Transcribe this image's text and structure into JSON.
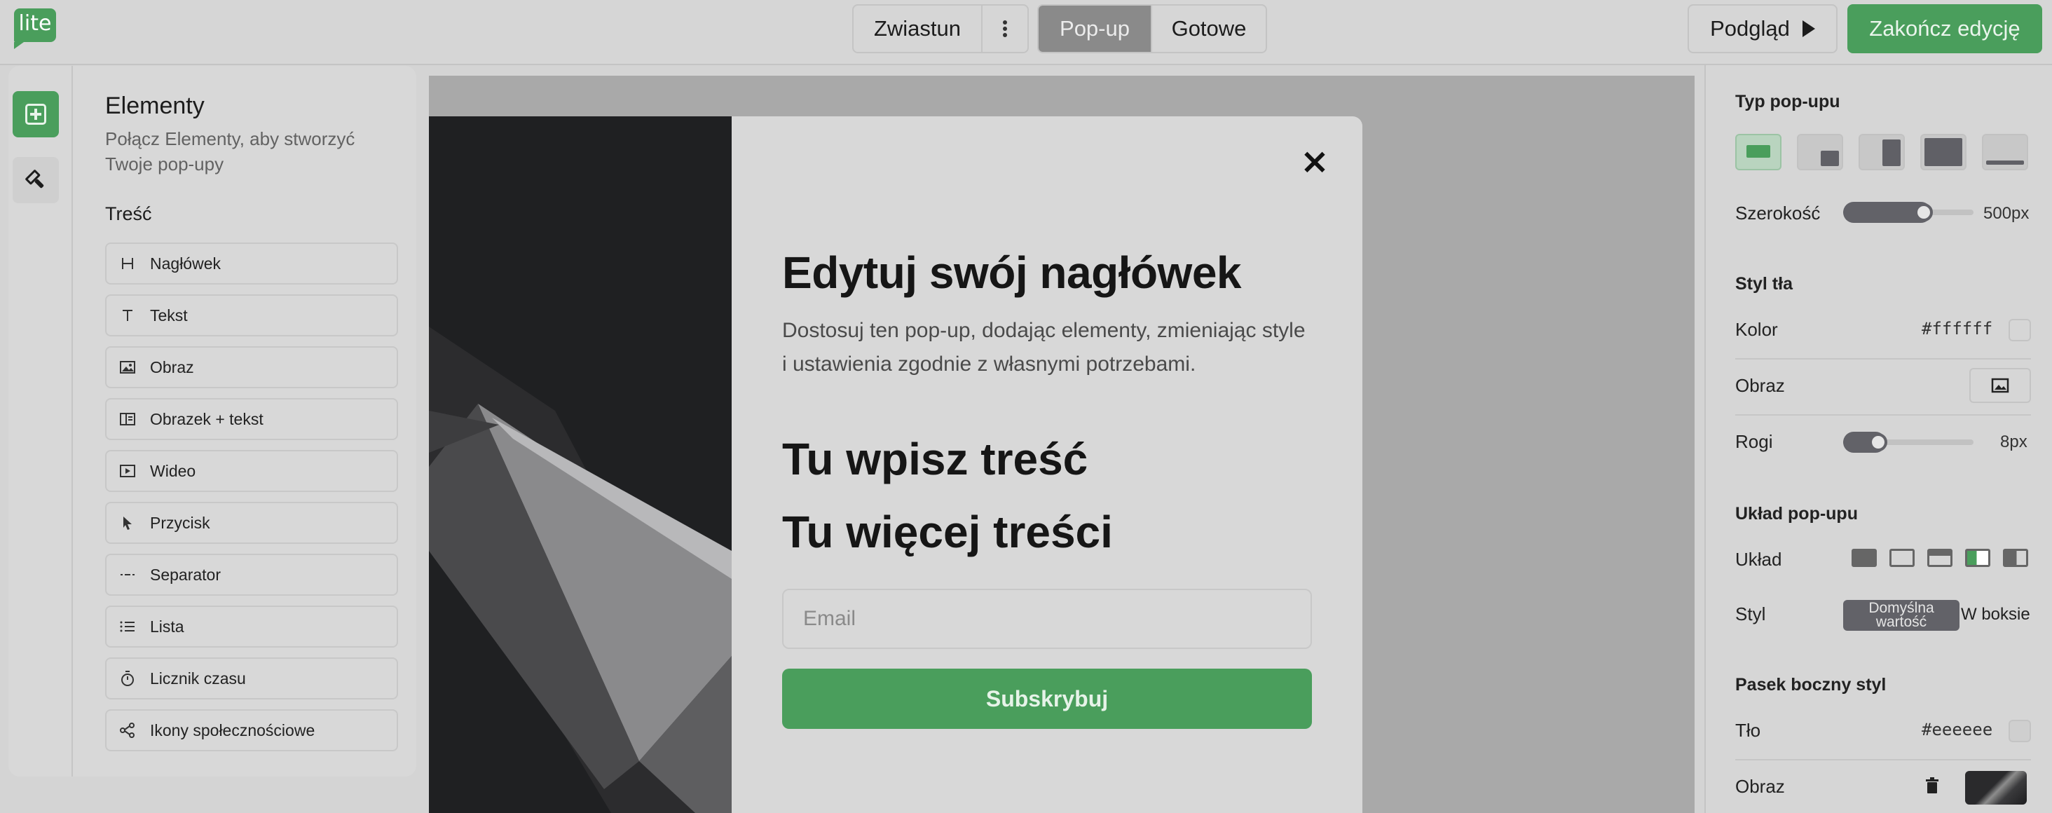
{
  "app": {
    "logo_text": "lite"
  },
  "header": {
    "tabs_left": [
      "Zwiastun"
    ],
    "tabs_right": [
      "Pop-up",
      "Gotowe"
    ],
    "active_tab": "Pop-up",
    "preview_label": "Podgląd",
    "finish_label": "Zakończ edycję"
  },
  "left_panel": {
    "title": "Elementy",
    "subtitle": "Połącz Elementy, aby stworzyć Twoje pop-upy",
    "section_label": "Treść",
    "items": [
      {
        "label": "Nagłówek",
        "icon": "heading-icon"
      },
      {
        "label": "Tekst",
        "icon": "text-icon"
      },
      {
        "label": "Obraz",
        "icon": "image-icon"
      },
      {
        "label": "Obrazek + tekst",
        "icon": "image-text-icon"
      },
      {
        "label": "Wideo",
        "icon": "video-icon"
      },
      {
        "label": "Przycisk",
        "icon": "cursor-icon"
      },
      {
        "label": "Separator",
        "icon": "separator-icon"
      },
      {
        "label": "Lista",
        "icon": "list-icon"
      },
      {
        "label": "Licznik czasu",
        "icon": "timer-icon"
      },
      {
        "label": "Ikony społecznościowe",
        "icon": "share-icon"
      }
    ]
  },
  "popup": {
    "headline": "Edytuj swój nagłówek",
    "description": "Dostosuj ten pop-up, dodając elementy, zmieniając style i ustawienia zgodnie z własnymi potrzebami.",
    "content_1": "Tu wpisz treść",
    "content_2": "Tu więcej treści",
    "email_placeholder": "Email",
    "subscribe_label": "Subskrybuj"
  },
  "right_panel": {
    "popup_type_heading": "Typ pop-upu",
    "width_label": "Szerokość",
    "width_value": "500px",
    "width_fraction": 0.6,
    "bg_style_heading": "Styl tła",
    "color_label": "Kolor",
    "color_value": "#ffffff",
    "image_label": "Obraz",
    "corners_label": "Rogi",
    "corners_value": "8px",
    "corners_fraction": 0.25,
    "layout_heading": "Układ pop-upu",
    "layout_label": "Układ",
    "style_label": "Styl",
    "style_options": [
      "Domyślna wartość",
      "W boksie"
    ],
    "sidebar_heading": "Pasek boczny styl",
    "sidebar_bg_label": "Tło",
    "sidebar_bg_value": "#eeeeee",
    "sidebar_image_label": "Obraz"
  },
  "colors": {
    "accent": "#4a9e5c",
    "selected_fill": "#626268"
  }
}
